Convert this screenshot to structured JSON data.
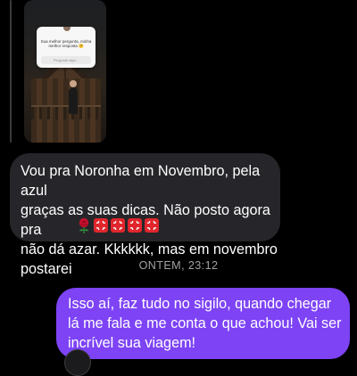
{
  "story_reply": {
    "question_sticker_text": "Sua melhor pergunta, minha melhor resposta 🤗",
    "sticker_input_placeholder": "Pergunte algo..."
  },
  "incoming_message": {
    "text": "Vou pra Noronha em Novembro, pela azul\ngraças as suas dicas. Não posto agora pra\nnão dá azar. Kkkkkk, mas em novembro\npostarei",
    "emojis": [
      "rose-emoji",
      "anger-emoji",
      "anger-emoji",
      "anger-emoji",
      "anger-emoji"
    ]
  },
  "divider": {
    "timestamp": "ONTEM, 23:12"
  },
  "outgoing_message": {
    "text": "Isso aí, faz tudo no sigilo, quando chegar\nlá me fala e me conta o que achou! Vai ser\nincrível sua viagem!"
  },
  "colors": {
    "background": "#000000",
    "incoming_bubble": "#26262a",
    "outgoing_bubble": "#7d43f5",
    "timestamp": "#a1a1a6",
    "anger_emoji": "#e0262c",
    "rose": "#c8102e"
  }
}
